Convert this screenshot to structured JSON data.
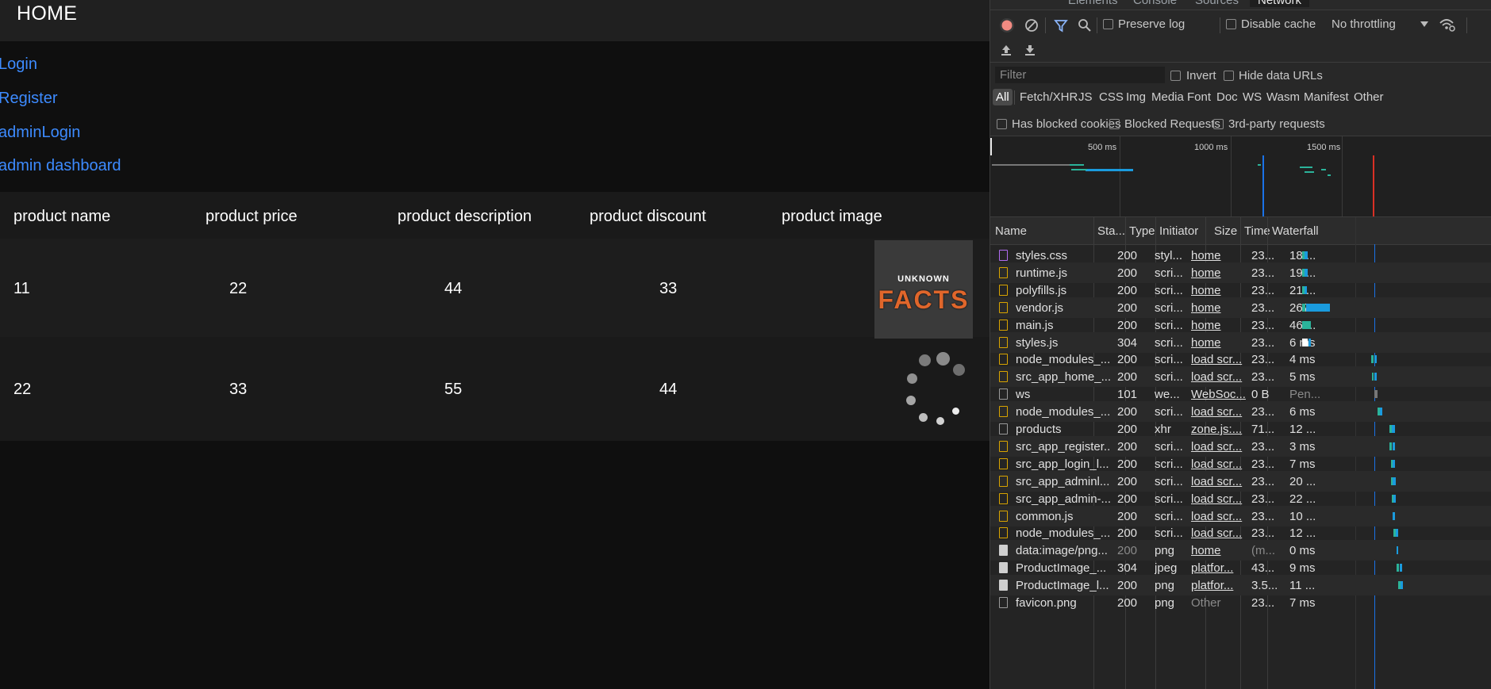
{
  "page": {
    "title": "HOME",
    "nav": [
      "Login",
      "Register",
      "adminLogin",
      "admin dashboard"
    ],
    "table": {
      "headers": [
        "product name",
        "product price",
        "product description",
        "product discount",
        "product image"
      ],
      "rows": [
        {
          "name": "11",
          "price": "22",
          "description": "44",
          "discount": "33",
          "image": "UNKNOWN FACTS"
        },
        {
          "name": "22",
          "price": "33",
          "description": "55",
          "discount": "44",
          "image": "loading"
        }
      ]
    },
    "image_text": {
      "top": "UNKNOWN",
      "bottom": "FACTS"
    }
  },
  "devtools": {
    "tabs": [
      "Elements",
      "Console",
      "Sources",
      "Network"
    ],
    "active_tab": "Network",
    "toolbar": {
      "preserve_log": "Preserve log",
      "disable_cache": "Disable cache",
      "throttling": "No throttling"
    },
    "filter": {
      "placeholder": "Filter",
      "invert": "Invert",
      "hide_data_urls": "Hide data URLs"
    },
    "types": [
      "All",
      "Fetch/XHR",
      "JS",
      "CSS",
      "Img",
      "Media",
      "Font",
      "Doc",
      "WS",
      "Wasm",
      "Manifest",
      "Other"
    ],
    "blocked": [
      "Has blocked cookies",
      "Blocked Requests",
      "3rd-party requests"
    ],
    "overview_labels": [
      "500 ms",
      "1000 ms",
      "1500 ms"
    ],
    "columns": [
      "Name",
      "Sta...",
      "Type",
      "Initiator",
      "Size",
      "Time",
      "Waterfall"
    ],
    "requests": [
      {
        "name": "styles.css",
        "status": "200",
        "type": "styl...",
        "initiator": "home",
        "size": "23...",
        "time": "18 ...",
        "icon": "css-file-icon"
      },
      {
        "name": "runtime.js",
        "status": "200",
        "type": "scri...",
        "initiator": "home",
        "size": "23...",
        "time": "19 ...",
        "icon": "js-file-icon"
      },
      {
        "name": "polyfills.js",
        "status": "200",
        "type": "scri...",
        "initiator": "home",
        "size": "23...",
        "time": "21 ...",
        "icon": "js-file-icon"
      },
      {
        "name": "vendor.js",
        "status": "200",
        "type": "scri...",
        "initiator": "home",
        "size": "23...",
        "time": "267...",
        "icon": "js-file-icon"
      },
      {
        "name": "main.js",
        "status": "200",
        "type": "scri...",
        "initiator": "home",
        "size": "23...",
        "time": "46 ...",
        "icon": "js-file-icon"
      },
      {
        "name": "styles.js",
        "status": "304",
        "type": "scri...",
        "initiator": "home",
        "size": "23...",
        "time": "6 ms",
        "icon": "js-file-icon"
      },
      {
        "name": "node_modules_...",
        "status": "200",
        "type": "scri...",
        "initiator": "load scr...",
        "size": "23...",
        "time": "4 ms",
        "icon": "js-file-icon"
      },
      {
        "name": "src_app_home_...",
        "status": "200",
        "type": "scri...",
        "initiator": "load scr...",
        "size": "23...",
        "time": "5 ms",
        "icon": "js-file-icon"
      },
      {
        "name": "ws",
        "status": "101",
        "type": "we...",
        "initiator": "WebSoc...",
        "size": "0 B",
        "time": "Pen...",
        "icon": "doc-file-icon"
      },
      {
        "name": "node_modules_...",
        "status": "200",
        "type": "scri...",
        "initiator": "load scr...",
        "size": "23...",
        "time": "6 ms",
        "icon": "js-file-icon"
      },
      {
        "name": "products",
        "status": "200",
        "type": "xhr",
        "initiator": "zone.js:...",
        "size": "71...",
        "time": "12 ...",
        "icon": "doc-file-icon"
      },
      {
        "name": "src_app_register...",
        "status": "200",
        "type": "scri...",
        "initiator": "load scr...",
        "size": "23...",
        "time": "3 ms",
        "icon": "js-file-icon"
      },
      {
        "name": "src_app_login_l...",
        "status": "200",
        "type": "scri...",
        "initiator": "load scr...",
        "size": "23...",
        "time": "7 ms",
        "icon": "js-file-icon"
      },
      {
        "name": "src_app_adminl...",
        "status": "200",
        "type": "scri...",
        "initiator": "load scr...",
        "size": "23...",
        "time": "20 ...",
        "icon": "js-file-icon"
      },
      {
        "name": "src_app_admin-...",
        "status": "200",
        "type": "scri...",
        "initiator": "load scr...",
        "size": "23...",
        "time": "22 ...",
        "icon": "js-file-icon"
      },
      {
        "name": "common.js",
        "status": "200",
        "type": "scri...",
        "initiator": "load scr...",
        "size": "23...",
        "time": "10 ...",
        "icon": "js-file-icon"
      },
      {
        "name": "node_modules_...",
        "status": "200",
        "type": "scri...",
        "initiator": "load scr...",
        "size": "23...",
        "time": "12 ...",
        "icon": "js-file-icon"
      },
      {
        "name": "data:image/png...",
        "status": "200",
        "type": "png",
        "initiator": "home",
        "size": "(m...",
        "time": "0 ms",
        "icon": "img-file-icon"
      },
      {
        "name": "ProductImage_...",
        "status": "304",
        "type": "jpeg",
        "initiator": "platfor...",
        "size": "43...",
        "time": "9 ms",
        "icon": "img-file-icon"
      },
      {
        "name": "ProductImage_l...",
        "status": "200",
        "type": "png",
        "initiator": "platfor...",
        "size": "3.5...",
        "time": "11 ...",
        "icon": "img-file-icon"
      },
      {
        "name": "favicon.png",
        "status": "200",
        "type": "png",
        "initiator": "Other",
        "size": "23...",
        "time": "7 ms",
        "icon": "doc-file-icon"
      }
    ]
  }
}
